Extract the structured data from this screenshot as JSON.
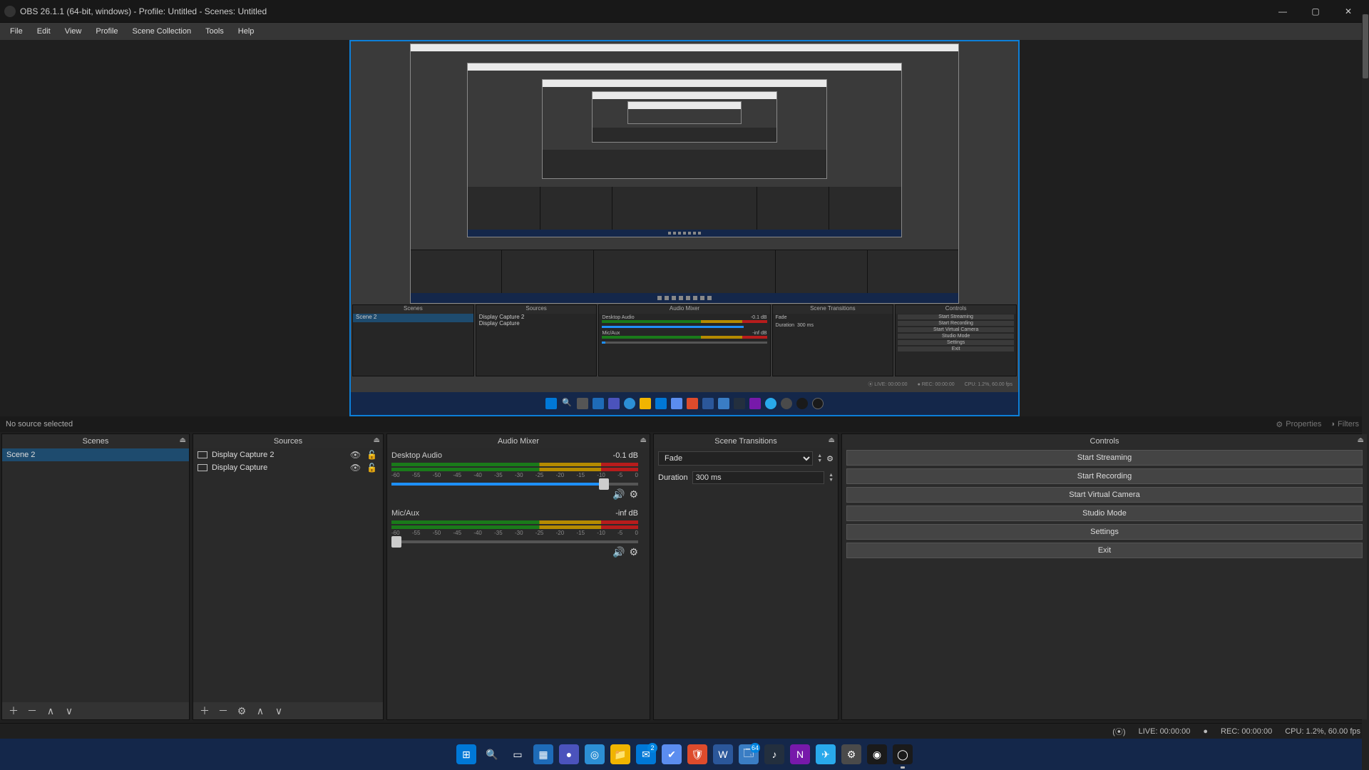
{
  "window": {
    "title": "OBS 26.1.1 (64-bit, windows) - Profile: Untitled - Scenes: Untitled"
  },
  "menu": [
    "File",
    "Edit",
    "View",
    "Profile",
    "Scene Collection",
    "Tools",
    "Help"
  ],
  "nosource": {
    "label": "No source selected",
    "properties": "Properties",
    "filters": "Filters"
  },
  "panels": {
    "scenes": {
      "title": "Scenes",
      "items": [
        "Scene 2"
      ]
    },
    "sources": {
      "title": "Sources",
      "items": [
        "Display Capture 2",
        "Display Capture"
      ]
    },
    "audio": {
      "title": "Audio Mixer",
      "tracks": [
        {
          "name": "Desktop Audio",
          "db": "-0.1 dB",
          "slider_pct": 86
        },
        {
          "name": "Mic/Aux",
          "db": "-inf dB",
          "slider_pct": 2
        }
      ],
      "scale": [
        "-60",
        "-55",
        "-50",
        "-45",
        "-40",
        "-35",
        "-30",
        "-25",
        "-20",
        "-15",
        "-10",
        "-5",
        "0"
      ]
    },
    "transitions": {
      "title": "Scene Transitions",
      "mode": "Fade",
      "duration_label": "Duration",
      "duration": "300 ms"
    },
    "controls": {
      "title": "Controls",
      "buttons": [
        "Start Streaming",
        "Start Recording",
        "Start Virtual Camera",
        "Studio Mode",
        "Settings",
        "Exit"
      ]
    }
  },
  "status": {
    "live_label": "LIVE:",
    "live_time": "00:00:00",
    "rec_label": "REC:",
    "rec_time": "00:00:00",
    "cpu": "CPU: 1.2%, 60.00 fps"
  },
  "taskbar_icons": [
    {
      "name": "start-icon",
      "bg": "#0078d7",
      "glyph": "⊞"
    },
    {
      "name": "search-icon",
      "bg": "transparent",
      "glyph": "🔍"
    },
    {
      "name": "taskview-icon",
      "bg": "transparent",
      "glyph": "▭"
    },
    {
      "name": "widgets-icon",
      "bg": "#1e6bb8",
      "glyph": "▦"
    },
    {
      "name": "teams-icon",
      "bg": "#4b53bc",
      "glyph": "●"
    },
    {
      "name": "edge-icon",
      "bg": "#2c8fd5",
      "glyph": "◎"
    },
    {
      "name": "explorer-icon",
      "bg": "#f0b400",
      "glyph": "📁"
    },
    {
      "name": "mail-icon",
      "bg": "#0078d7",
      "glyph": "✉",
      "badge": "2"
    },
    {
      "name": "todo-icon",
      "bg": "#5b8def",
      "glyph": "✔"
    },
    {
      "name": "brave-icon",
      "bg": "#dd4b2c",
      "glyph": "🛡"
    },
    {
      "name": "word-icon",
      "bg": "#2b579a",
      "glyph": "W"
    },
    {
      "name": "app-icon-1",
      "bg": "#3a7dc4",
      "glyph": "🗔",
      "badge": "64"
    },
    {
      "name": "amazon-music-icon",
      "bg": "#232f3e",
      "glyph": "♪"
    },
    {
      "name": "onenote-icon",
      "bg": "#7719aa",
      "glyph": "N"
    },
    {
      "name": "telegram-icon",
      "bg": "#29a9eb",
      "glyph": "✈"
    },
    {
      "name": "settings-icon",
      "bg": "#4a4a4a",
      "glyph": "⚙"
    },
    {
      "name": "davinci-icon",
      "bg": "#1a1a1a",
      "glyph": "◉"
    },
    {
      "name": "obs-icon",
      "bg": "#1a1a1a",
      "glyph": "◯",
      "running": true
    }
  ]
}
